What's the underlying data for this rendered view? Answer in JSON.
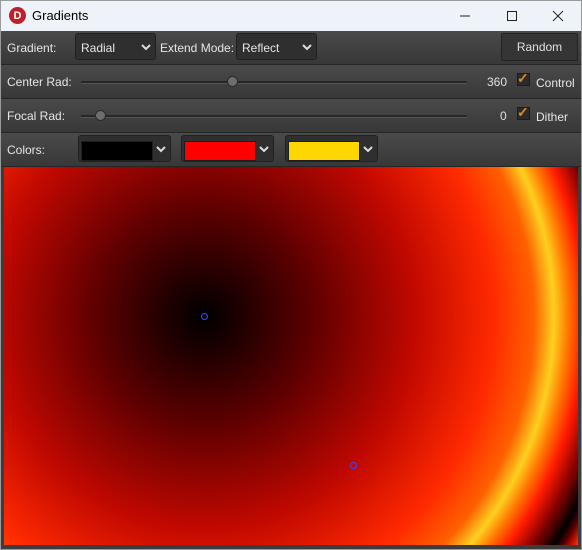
{
  "window": {
    "title": "Gradients",
    "icon": "d-app-icon"
  },
  "toolbar": {
    "gradient_label": "Gradient:",
    "gradient_value": "Radial",
    "extend_label": "Extend Mode:",
    "extend_value": "Reflect",
    "random_label": "Random"
  },
  "center_rad": {
    "label": "Center Rad:",
    "value": "360",
    "slider_fraction": 0.39,
    "control_label": "Control",
    "control_checked": true
  },
  "focal_rad": {
    "label": "Focal Rad:",
    "value": "0",
    "slider_fraction": 0.05,
    "dither_label": "Dither",
    "dither_checked": true
  },
  "colors": {
    "label": "Colors:",
    "stops": [
      "#000000",
      "#ff0000",
      "#ffd700"
    ]
  }
}
